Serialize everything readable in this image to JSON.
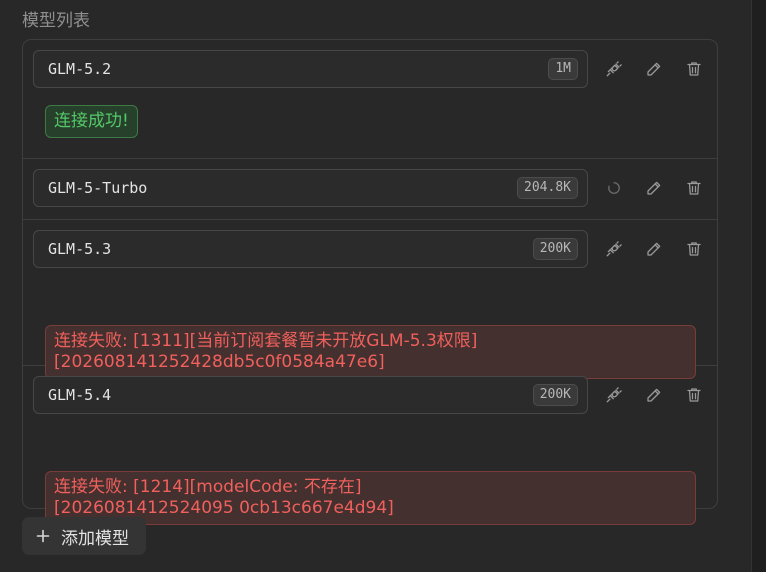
{
  "section": {
    "title": "模型列表"
  },
  "models": [
    {
      "name": "GLM-5.2",
      "context": "1M",
      "status": {
        "type": "success",
        "lines": [
          "连接成功!"
        ]
      }
    },
    {
      "name": "GLM-5-Turbo",
      "context": "204.8K",
      "testing": true
    },
    {
      "name": "GLM-5.3",
      "context": "200K",
      "status": {
        "type": "error",
        "lines": [
          "连接失败: [1311][当前订阅套餐暂未开放GLM-5.3权限]",
          "[202608141252428db5c0f0584a47e6]"
        ]
      }
    },
    {
      "name": "GLM-5.4",
      "context": "200K",
      "status": {
        "type": "error",
        "lines": [
          "连接失败: [1214][modelCode: 不存在]",
          "[2026081412524095 0cb13c667e4d94]"
        ]
      }
    }
  ],
  "actions": {
    "add_model_label": "添加模型"
  },
  "icons": {
    "test": "plug-icon",
    "testing": "spinner-icon",
    "edit": "pencil-icon",
    "delete": "trash-icon",
    "add": "plus-icon"
  },
  "colors": {
    "success_text": "#54c768",
    "error_text": "#f0605c"
  }
}
